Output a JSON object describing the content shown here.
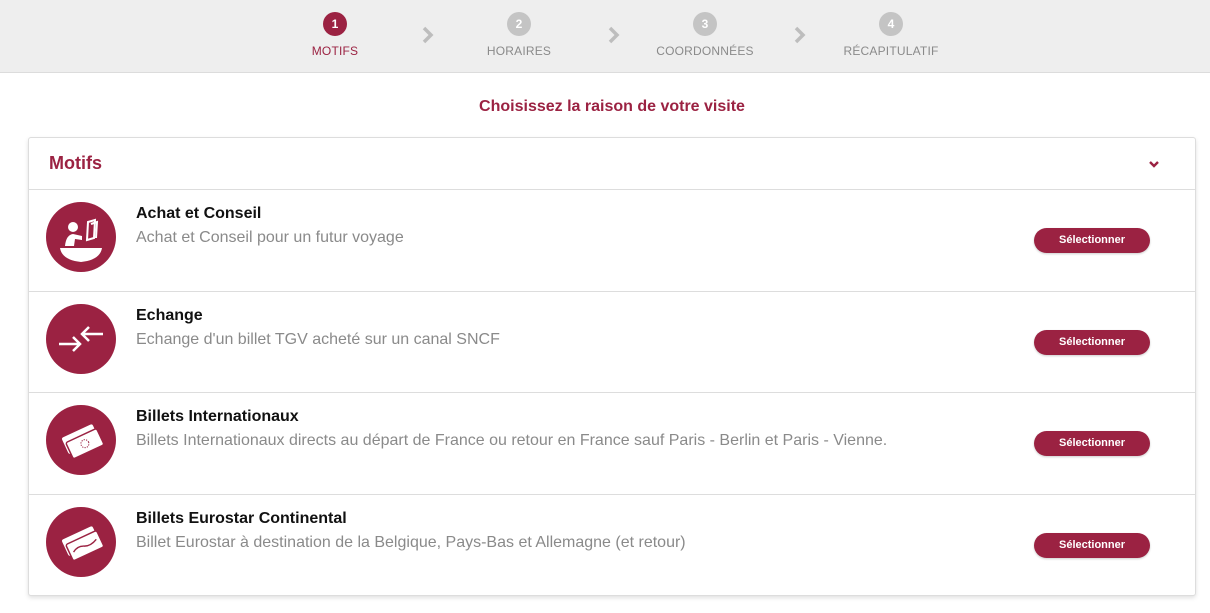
{
  "stepper": {
    "steps": [
      {
        "number": "1",
        "label": "MOTIFS"
      },
      {
        "number": "2",
        "label": "HORAIRES"
      },
      {
        "number": "3",
        "label": "COORDONNÉES"
      },
      {
        "number": "4",
        "label": "RÉCAPITULATIF"
      }
    ],
    "active_step": 1
  },
  "page": {
    "heading": "Choisissez la raison de votre visite"
  },
  "panel": {
    "title": "Motifs",
    "toggle_icon": "chevron-down-icon",
    "items": [
      {
        "icon": "ticket-counter-icon",
        "title": "Achat et Conseil",
        "description": "Achat et Conseil pour un futur voyage",
        "button": "Sélectionner"
      },
      {
        "icon": "exchange-arrows-icon",
        "title": "Echange",
        "description": "Echange d'un billet TGV acheté sur un canal SNCF",
        "button": "Sélectionner"
      },
      {
        "icon": "international-tickets-icon",
        "title": "Billets Internationaux",
        "description": "Billets Internationaux directs au départ de France ou retour en France sauf Paris - Berlin et Paris - Vienne.",
        "button": "Sélectionner"
      },
      {
        "icon": "eurostar-ticket-icon",
        "title": "Billets Eurostar Continental",
        "description": "Billet Eurostar à destination de la Belgique, Pays-Bas et Allemagne (et retour)",
        "button": "Sélectionner"
      }
    ]
  },
  "colors": {
    "accent": "#9b2242",
    "inactive": "#c4c4c4",
    "stepper_bg": "#eeeeee"
  }
}
